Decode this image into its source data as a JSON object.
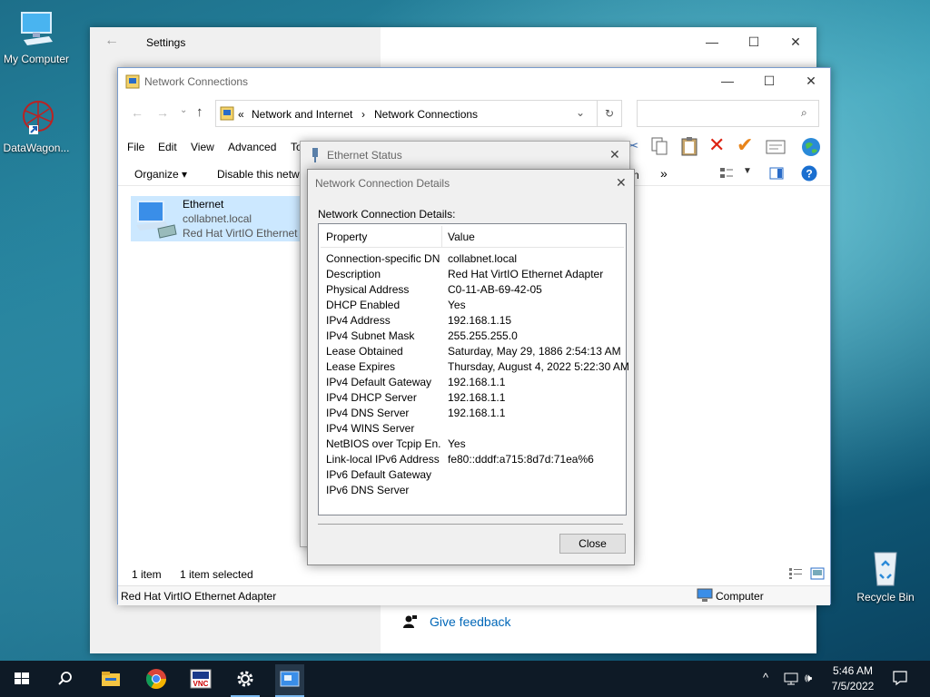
{
  "desktop": {
    "icons": [
      {
        "label": "My Computer"
      },
      {
        "label": "DataWagon..."
      },
      {
        "label": "Recycle Bin"
      }
    ]
  },
  "settings": {
    "title": "Settings",
    "feedback": "Give feedback"
  },
  "netconn": {
    "title": "Network Connections",
    "breadcrumb": {
      "sep": "«",
      "part1": "Network and Internet",
      "arrow": "›",
      "part2": "Network Connections"
    },
    "menu": {
      "file": "File",
      "edit": "Edit",
      "view": "View",
      "advanced": "Advanced",
      "tools": "To"
    },
    "cmd": {
      "organize": "Organize ▾",
      "disable": "Disable this netwo",
      "more": "»"
    },
    "item": {
      "name": "Ethernet",
      "domain": "collabnet.local",
      "adapter": "Red Hat VirtIO Ethernet A"
    },
    "status": {
      "count": "1 item",
      "selected": "1 item selected"
    },
    "bottom": {
      "left": "Red Hat VirtIO Ethernet Adapter",
      "right": "Computer"
    }
  },
  "ethstatus": {
    "title": "Ethernet Status",
    "peek": "n"
  },
  "details": {
    "title": "Network Connection Details",
    "label": "Network Connection Details:",
    "col_property": "Property",
    "col_value": "Value",
    "rows": [
      {
        "p": "Connection-specific DN...",
        "v": "collabnet.local"
      },
      {
        "p": "Description",
        "v": "Red Hat VirtIO Ethernet Adapter"
      },
      {
        "p": "Physical Address",
        "v": "C0-11-AB-69-42-05"
      },
      {
        "p": "DHCP Enabled",
        "v": "Yes"
      },
      {
        "p": "IPv4 Address",
        "v": "192.168.1.15"
      },
      {
        "p": "IPv4 Subnet Mask",
        "v": "255.255.255.0"
      },
      {
        "p": "Lease Obtained",
        "v": "Saturday, May 29, 1886 2:54:13 AM"
      },
      {
        "p": "Lease Expires",
        "v": "Thursday, August 4, 2022 5:22:30 AM"
      },
      {
        "p": "IPv4 Default Gateway",
        "v": "192.168.1.1"
      },
      {
        "p": "IPv4 DHCP Server",
        "v": "192.168.1.1"
      },
      {
        "p": "IPv4 DNS Server",
        "v": "192.168.1.1"
      },
      {
        "p": "IPv4 WINS Server",
        "v": ""
      },
      {
        "p": "NetBIOS over Tcpip En...",
        "v": "Yes"
      },
      {
        "p": "Link-local IPv6 Address",
        "v": "fe80::dddf:a715:8d7d:71ea%6"
      },
      {
        "p": "IPv6 Default Gateway",
        "v": ""
      },
      {
        "p": "IPv6 DNS Server",
        "v": ""
      }
    ],
    "close": "Close"
  },
  "taskbar": {
    "time": "5:46 AM",
    "date": "7/5/2022"
  }
}
